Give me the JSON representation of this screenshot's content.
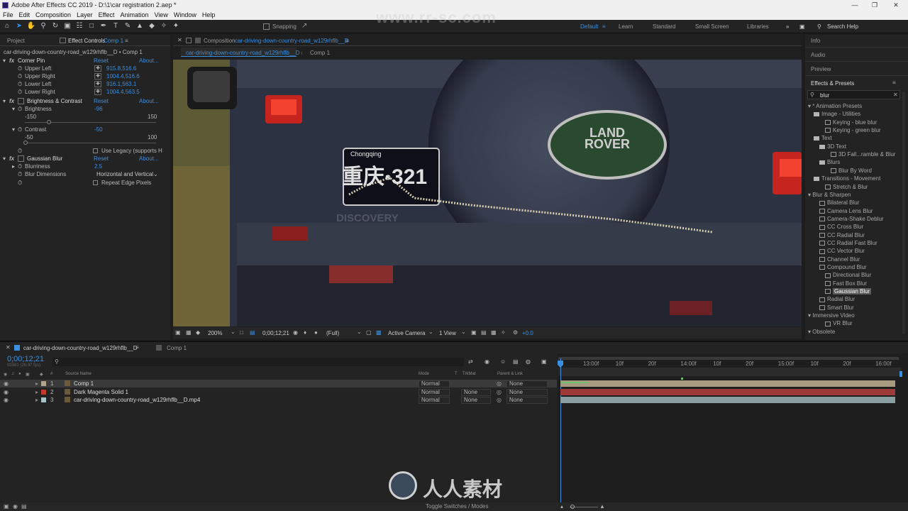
{
  "window": {
    "title": "Adobe After Effects CC 2019 - D:\\1\\car registration 2.aep *"
  },
  "menu": [
    "File",
    "Edit",
    "Composition",
    "Layer",
    "Effect",
    "Animation",
    "View",
    "Window",
    "Help"
  ],
  "toolbar": {
    "snapping_label": "Snapping",
    "workspaces": [
      "Default",
      "Learn",
      "Standard",
      "Small Screen",
      "Libraries"
    ],
    "search_placeholder": "Search Help"
  },
  "watermark_top": "www.rr-sc.com",
  "left_panel": {
    "tabs": [
      "Project",
      "Effect Controls",
      "Comp 1"
    ],
    "header": "car-driving-down-country-road_w129rhflb__D • Comp 1",
    "effects": [
      {
        "name": "Corner Pin",
        "reset": "Reset",
        "about": "About...",
        "params": [
          {
            "label": "Upper Left",
            "value": "915.8,516.6"
          },
          {
            "label": "Upper Right",
            "value": "1004.4,516.6"
          },
          {
            "label": "Lower Left",
            "value": "916.1,563.1"
          },
          {
            "label": "Lower Right",
            "value": "1004.4,563.5"
          }
        ]
      },
      {
        "name": "Brightness & Contrast",
        "reset": "Reset",
        "about": "About...",
        "brightness": {
          "label": "Brightness",
          "value": "-96",
          "min": "-150",
          "max": "150"
        },
        "contrast": {
          "label": "Contrast",
          "value": "-50",
          "min": "-50",
          "max": "100"
        },
        "legacy_label": "Use Legacy (supports H"
      },
      {
        "name": "Gaussian Blur",
        "reset": "Reset",
        "about": "About...",
        "blurriness": {
          "label": "Blurriness",
          "value": "2.5"
        },
        "dimensions": {
          "label": "Blur Dimensions",
          "value": "Horizontal and Vertical"
        },
        "repeat_label": "Repeat Edge Pixels"
      }
    ]
  },
  "composition": {
    "panel_tab_prefix": "Composition",
    "panel_tab_name": "car-driving-down-country-road_w129rhflb__D",
    "breadcrumbs": [
      "car-driving-down-country-road_w129rhflb__D",
      "Comp 1"
    ],
    "plate_top": "Chongqing",
    "plate_main": "重庆·321",
    "spare_logo": "LAND ROVER",
    "bumper_text": "DISCOVERY",
    "footer": {
      "zoom": "200%",
      "timecode": "0;00;12;21",
      "resolution": "(Full)",
      "camera": "Active Camera",
      "view": "1 View",
      "exposure": "+0.0"
    }
  },
  "right_panel": {
    "sections": [
      "Info",
      "Audio",
      "Preview",
      "Effects & Presets"
    ],
    "search_value": "blur",
    "tree": [
      {
        "label": "* Animation Presets",
        "indent": 0,
        "kind": "caret"
      },
      {
        "label": "Image - Utilities",
        "indent": 1,
        "kind": "folder"
      },
      {
        "label": "Keying - blue blur",
        "indent": 3,
        "kind": "preset"
      },
      {
        "label": "Keying - green blur",
        "indent": 3,
        "kind": "preset"
      },
      {
        "label": "Text",
        "indent": 1,
        "kind": "folder"
      },
      {
        "label": "3D Text",
        "indent": 2,
        "kind": "folder"
      },
      {
        "label": "3D Fall...ramble & Blur",
        "indent": 4,
        "kind": "preset"
      },
      {
        "label": "Blurs",
        "indent": 2,
        "kind": "folder"
      },
      {
        "label": "Blur By Word",
        "indent": 4,
        "kind": "preset"
      },
      {
        "label": "Transitions - Movement",
        "indent": 1,
        "kind": "folder"
      },
      {
        "label": "Stretch & Blur",
        "indent": 3,
        "kind": "preset"
      },
      {
        "label": "Blur & Sharpen",
        "indent": 0,
        "kind": "caret"
      },
      {
        "label": "Bilateral Blur",
        "indent": 2,
        "kind": "preset"
      },
      {
        "label": "Camera Lens Blur",
        "indent": 2,
        "kind": "preset"
      },
      {
        "label": "Camera-Shake Deblur",
        "indent": 2,
        "kind": "preset"
      },
      {
        "label": "CC Cross Blur",
        "indent": 2,
        "kind": "preset"
      },
      {
        "label": "CC Radial Blur",
        "indent": 2,
        "kind": "preset"
      },
      {
        "label": "CC Radial Fast Blur",
        "indent": 2,
        "kind": "preset"
      },
      {
        "label": "CC Vector Blur",
        "indent": 2,
        "kind": "preset"
      },
      {
        "label": "Channel Blur",
        "indent": 2,
        "kind": "preset"
      },
      {
        "label": "Compound Blur",
        "indent": 2,
        "kind": "preset"
      },
      {
        "label": "Directional Blur",
        "indent": 3,
        "kind": "preset"
      },
      {
        "label": "Fast Box Blur",
        "indent": 3,
        "kind": "preset"
      },
      {
        "label": "Gaussian Blur",
        "indent": 3,
        "kind": "preset",
        "selected": true
      },
      {
        "label": "Radial Blur",
        "indent": 2,
        "kind": "preset"
      },
      {
        "label": "Smart Blur",
        "indent": 2,
        "kind": "preset"
      },
      {
        "label": "Immersive Video",
        "indent": 0,
        "kind": "caret"
      },
      {
        "label": "VR Blur",
        "indent": 3,
        "kind": "preset"
      },
      {
        "label": "Obsolete",
        "indent": 0,
        "kind": "caret"
      }
    ]
  },
  "timeline": {
    "tabs": [
      "car-driving-down-country-road_w129rhflb__D",
      "Comp 1"
    ],
    "timecode": "0;00;12;21",
    "timecode_sub": "00381 (29.97 fps)",
    "columns": {
      "source": "Source Name",
      "mode": "Mode",
      "t": "T",
      "trkmat": "TrkMat",
      "parent": "Parent & Link"
    },
    "layers": [
      {
        "num": "1",
        "name": "Comp 1",
        "mode": "Normal",
        "trkmat": "",
        "parent": "None",
        "color": "#b0a58a",
        "bar": "#a79a7e",
        "selected": true
      },
      {
        "num": "2",
        "name": "Dark Magenta Solid 1",
        "mode": "Normal",
        "trkmat": "None",
        "parent": "None",
        "color": "#c0392b",
        "bar": "#9e3a3a"
      },
      {
        "num": "3",
        "name": "car-driving-down-country-road_w129rhflb__D.mp4",
        "mode": "Normal",
        "trkmat": "None",
        "parent": "None",
        "color": "#a7c5c9",
        "bar": "#8a9fa1"
      }
    ],
    "ruler": [
      "13:00f",
      "10f",
      "20f",
      "14:00f",
      "10f",
      "20f",
      "15:00f",
      "10f",
      "20f",
      "16:00f"
    ],
    "footer": "Toggle Switches / Modes"
  },
  "logo_text": "人人素材"
}
